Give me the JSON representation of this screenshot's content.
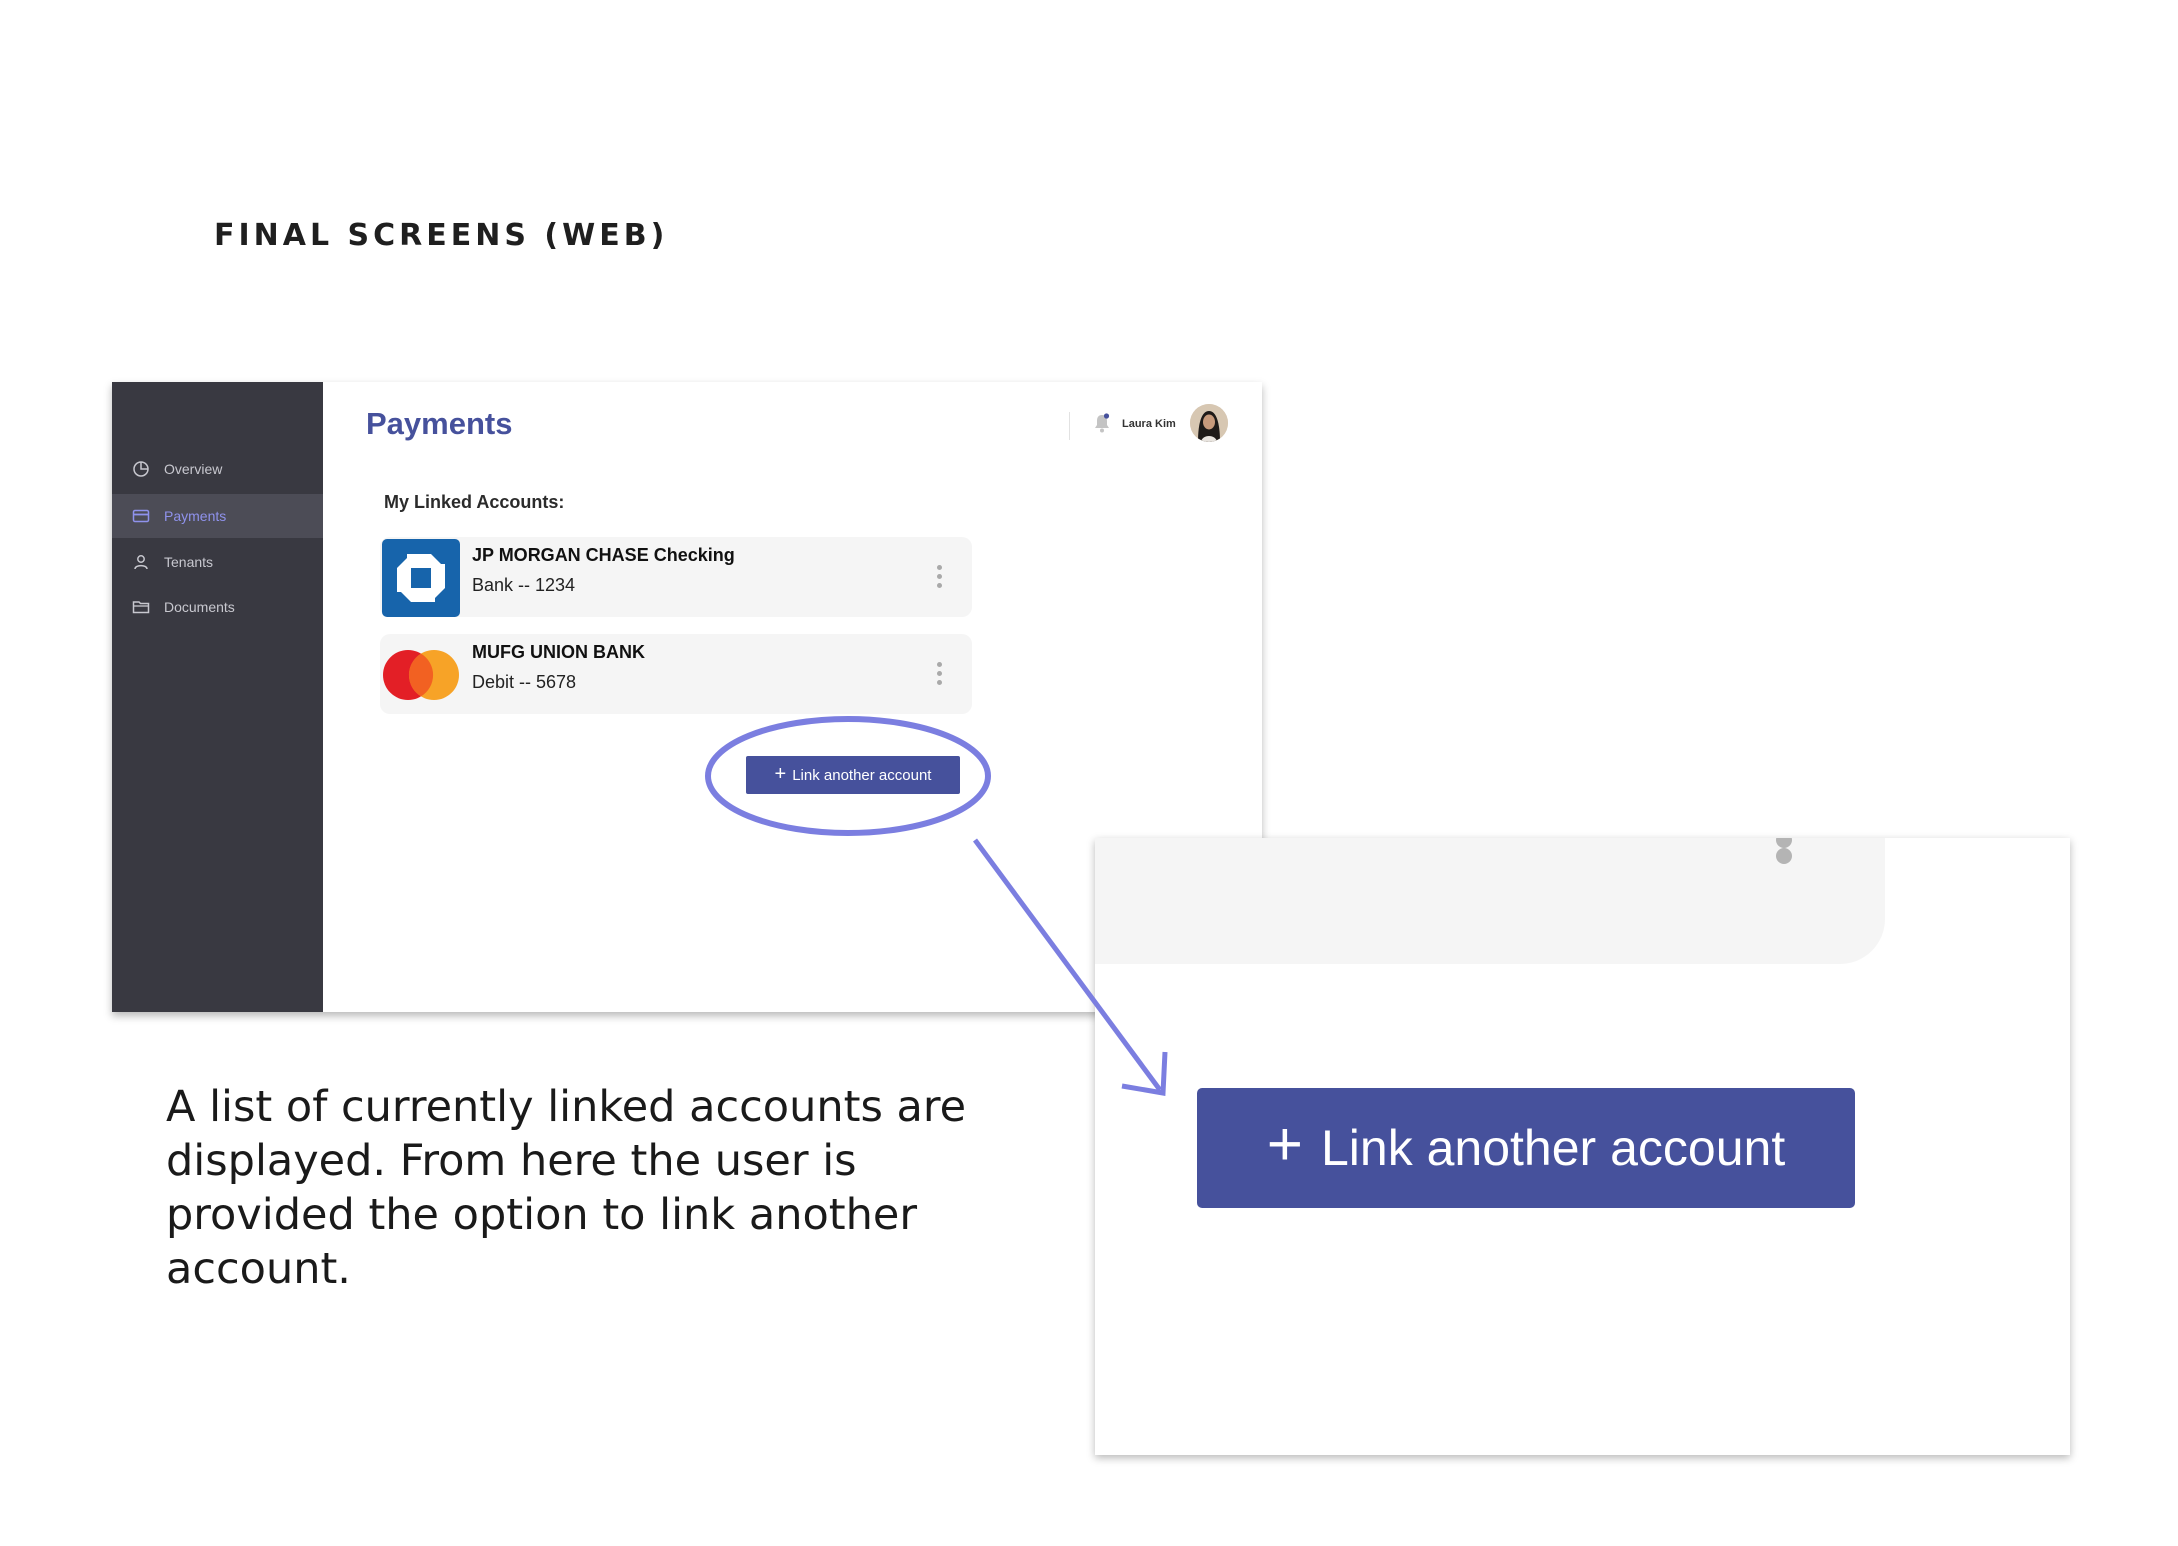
{
  "page": {
    "heading": "FINAL SCREENS (WEB)"
  },
  "app": {
    "sidebar": {
      "items": [
        {
          "label": "Overview",
          "icon": "pie-chart-icon",
          "active": false
        },
        {
          "label": "Payments",
          "icon": "credit-card-icon",
          "active": true
        },
        {
          "label": "Tenants",
          "icon": "person-icon",
          "active": false
        },
        {
          "label": "Documents",
          "icon": "folder-icon",
          "active": false
        }
      ]
    },
    "header": {
      "title": "Payments",
      "user_name": "Laura Kim"
    },
    "linked_accounts": {
      "label": "My Linked Accounts:",
      "accounts": [
        {
          "name": "JP MORGAN CHASE Checking",
          "detail": "Bank -- 1234",
          "logo": "chase-logo"
        },
        {
          "name": "MUFG UNION BANK",
          "detail": "Debit -- 5678",
          "logo": "mastercard-logo"
        }
      ]
    },
    "link_button": {
      "label": "Link another account"
    }
  },
  "description": "A list of currently linked accounts are displayed. From here the user is provided the option to link another account.",
  "zoom": {
    "button_label": "Link another account"
  },
  "colors": {
    "sidebar": "#393941",
    "accent": "#46519c",
    "active_nav": "#8f92ec",
    "annotation": "#7b7ee0"
  }
}
